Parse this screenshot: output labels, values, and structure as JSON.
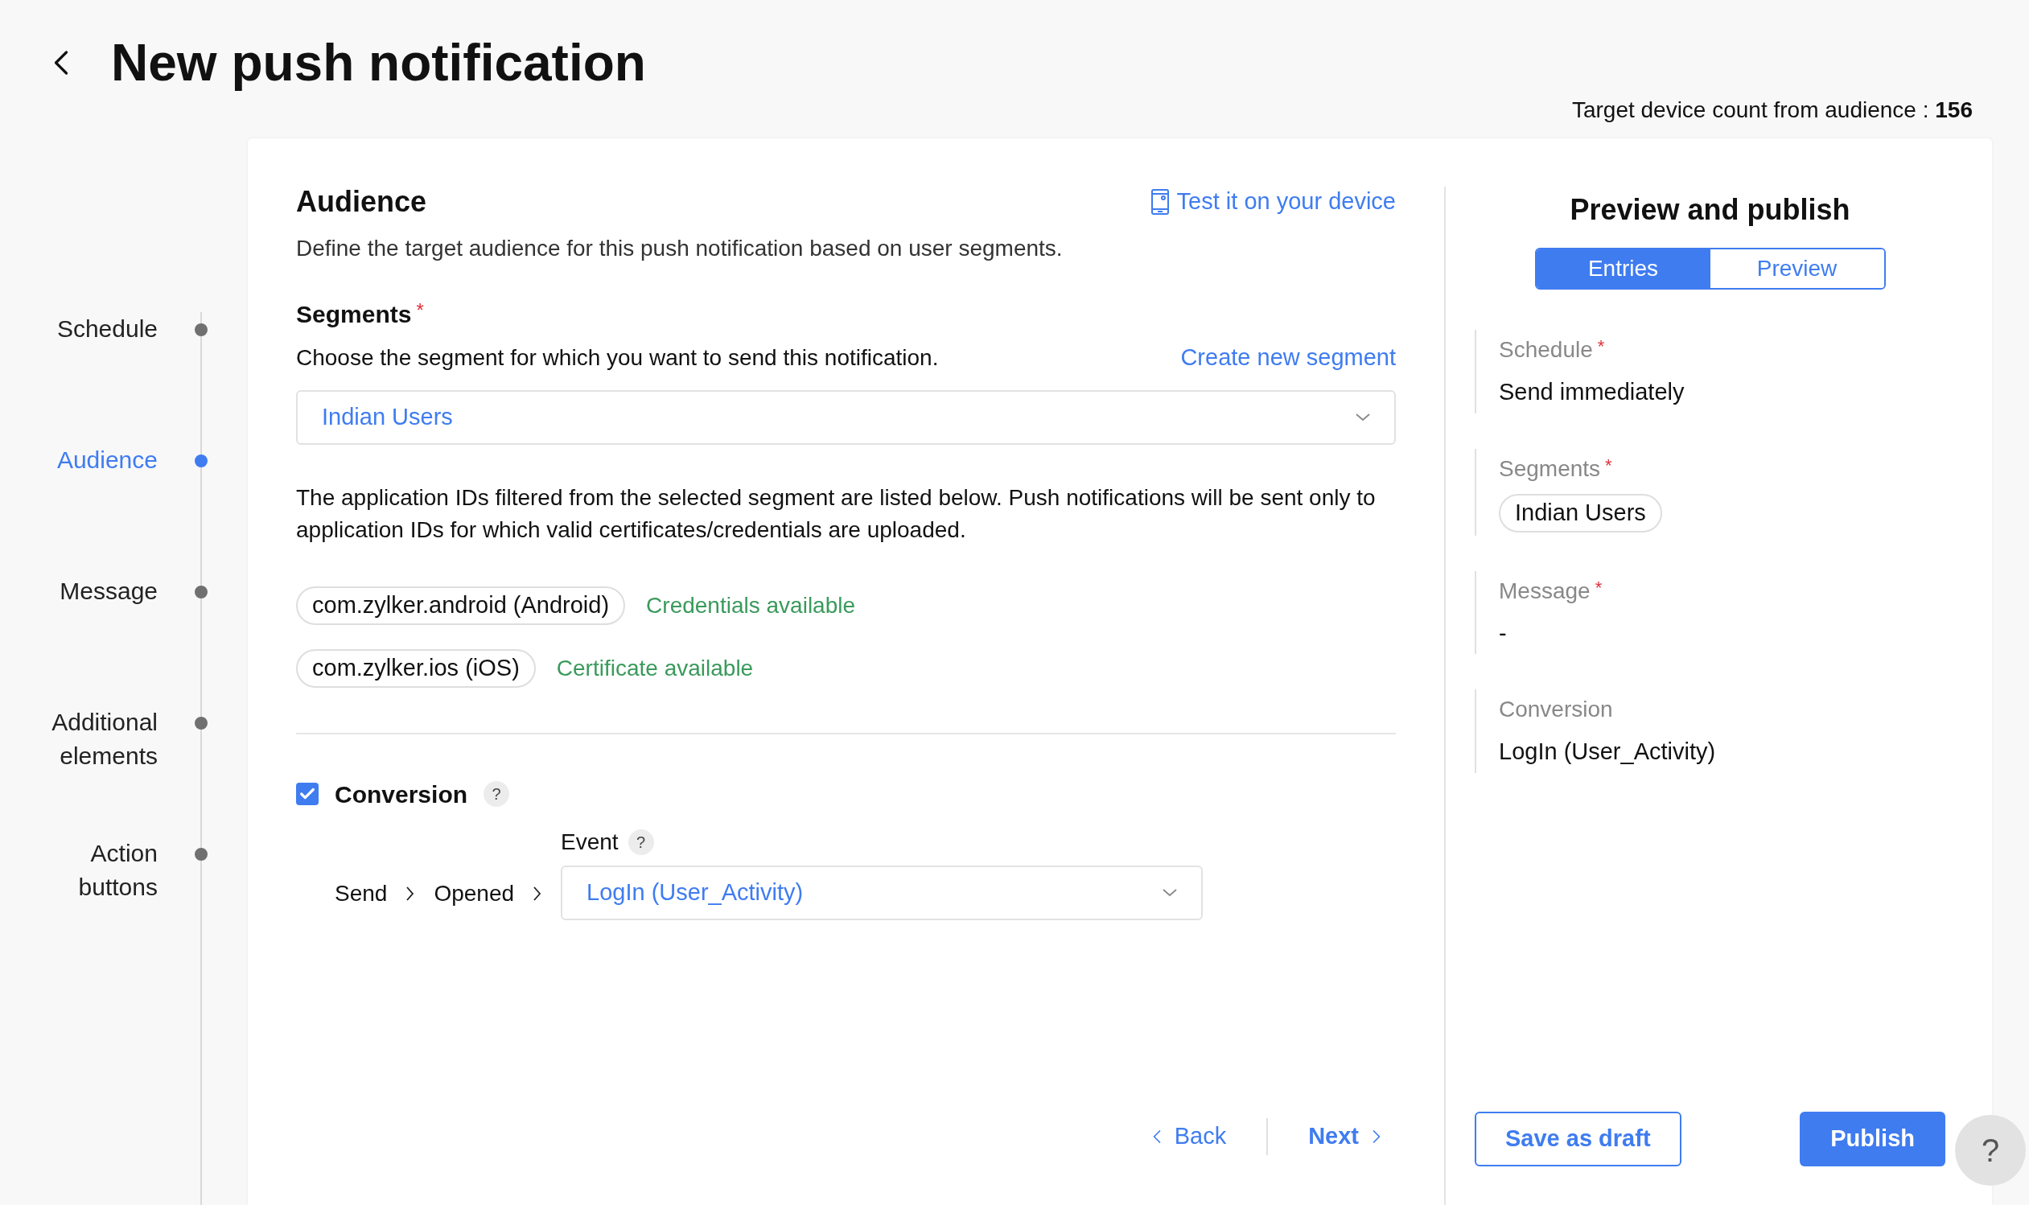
{
  "header": {
    "title": "New push notification",
    "device_count_label": "Target device count from audience :",
    "device_count": "156"
  },
  "steps": [
    {
      "label": "Schedule",
      "selected": false
    },
    {
      "label": "Audience",
      "selected": true
    },
    {
      "label": "Message",
      "selected": false
    },
    {
      "label": "Additional elements",
      "selected": false
    },
    {
      "label": "Action buttons",
      "selected": false
    }
  ],
  "audience": {
    "title": "Audience",
    "description": "Define the target audience for this push notification based on user segments.",
    "test_link": "Test it on your device",
    "segments_label": "Segments",
    "required_mark": "*",
    "segments_hint": "Choose the segment for which you want to send this notification.",
    "create_link": "Create new segment",
    "segment_value": "Indian Users",
    "info": "The application IDs filtered from the selected segment are listed below. Push notifications will be sent only to application IDs for which valid certificates/credentials are uploaded.",
    "apps": [
      {
        "id": "com.zylker.android (Android)",
        "status": "Credentials available"
      },
      {
        "id": "com.zylker.ios (iOS)",
        "status": "Certificate available"
      }
    ],
    "conversion": {
      "checked": true,
      "label": "Conversion",
      "help": "?",
      "event_label": "Event",
      "event_help": "?",
      "flow": [
        "Send",
        "Opened"
      ],
      "event_value": "LogIn (User_Activity)"
    },
    "nav": {
      "back": "Back",
      "next": "Next"
    }
  },
  "preview": {
    "title": "Preview and publish",
    "tabs": [
      {
        "label": "Entries",
        "selected": true
      },
      {
        "label": "Preview",
        "selected": false
      }
    ],
    "entries": [
      {
        "kind": "text",
        "label": "Schedule",
        "required_mark": "*",
        "value": "Send immediately"
      },
      {
        "kind": "chip",
        "label": "Segments",
        "required_mark": "*",
        "value": "Indian Users"
      },
      {
        "kind": "text",
        "label": "Message",
        "required_mark": "*",
        "value": "-"
      },
      {
        "kind": "text",
        "label": "Conversion",
        "value": "LogIn (User_Activity)"
      }
    ],
    "save_draft": "Save as draft",
    "publish": "Publish"
  },
  "help_button": "?"
}
